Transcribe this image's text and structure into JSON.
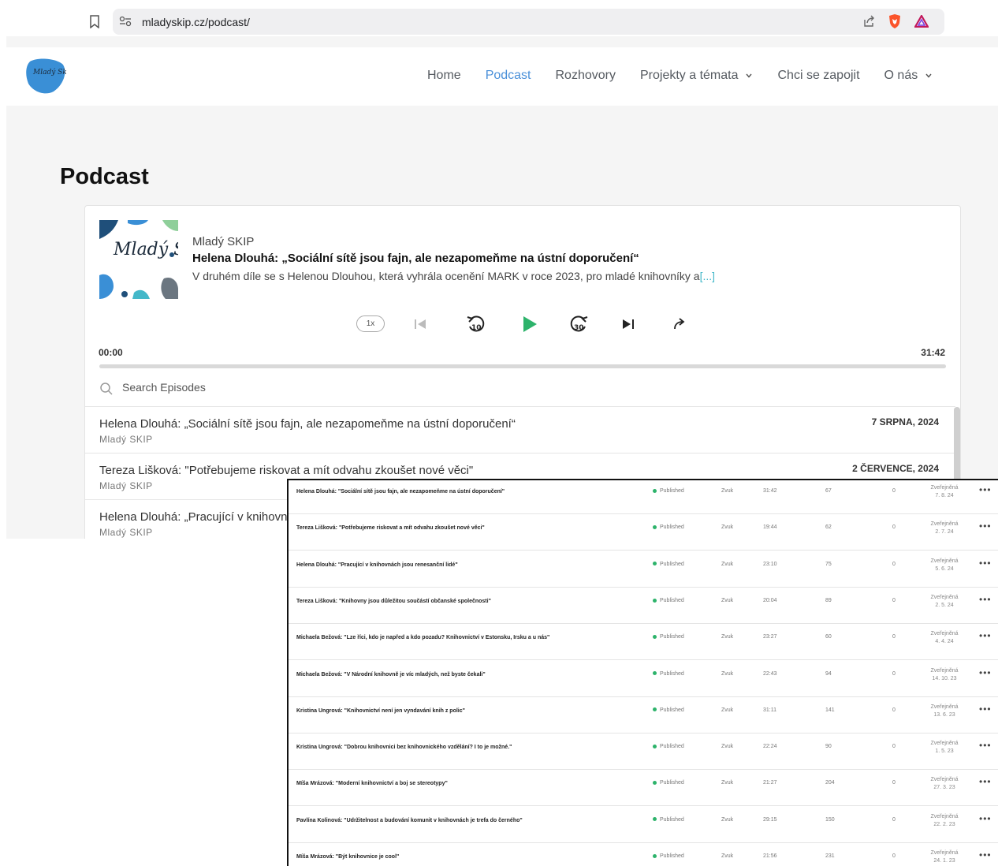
{
  "browser": {
    "url": "mladyskip.cz/podcast/"
  },
  "nav": {
    "items": [
      {
        "label": "Home",
        "active": false,
        "dropdown": false
      },
      {
        "label": "Podcast",
        "active": true,
        "dropdown": false
      },
      {
        "label": "Rozhovory",
        "active": false,
        "dropdown": false
      },
      {
        "label": "Projekty a témata",
        "active": false,
        "dropdown": true
      },
      {
        "label": "Chci se zapojit",
        "active": false,
        "dropdown": false
      },
      {
        "label": "O nás",
        "active": false,
        "dropdown": true
      }
    ]
  },
  "logo_text": "Mladý Skip",
  "page": {
    "title": "Podcast"
  },
  "player": {
    "show_name": "Mladý SKIP",
    "episode_title": "Helena Dlouhá: „Sociální sítě jsou fajn, ale nezapomeňme na ústní doporučení“",
    "description": "V druhém díle se s Helenou Dlouhou, která vyhrála ocenění MARK v roce 2023, pro mladé knihovníky a",
    "more_label": "[...]",
    "speed": "1x",
    "skip_back": "10",
    "skip_forward": "30",
    "time_current": "00:00",
    "time_total": "31:42",
    "progress": 0
  },
  "search": {
    "placeholder": "Search Episodes"
  },
  "episodes": [
    {
      "title": "Helena Dlouhá: „Sociální sítě jsou fajn, ale nezapomeňme na ústní doporučení“",
      "show": "Mladý SKIP",
      "date": "7 SRPNA, 2024"
    },
    {
      "title": "Tereza Lišková: \"Potřebujeme riskovat a mít odvahu zkoušet nové věci\"",
      "show": "Mladý SKIP",
      "date": "2 ČERVENCE, 2024"
    },
    {
      "title": "Helena Dlouhá: „Pracující v knihovnách jsou renesanční lidé“",
      "show": "Mladý SKIP",
      "date": ""
    }
  ],
  "colors": {
    "accent": "#4a90d9",
    "play": "#2db36b",
    "teal": "#44b8c9",
    "published_dot": "#2db36b"
  },
  "admin_table": {
    "status_label": "Published",
    "type_label": "Zvuk",
    "pub_label": "Zveřejněná",
    "rows": [
      {
        "title": "Helena Dlouhá: \"Sociální sítě jsou fajn, ale nezapomeňme na ústní doporučení\"",
        "duration": "31:42",
        "plays": "67",
        "zero": "0",
        "date": "7. 8. 24"
      },
      {
        "title": "Tereza Lišková: \"Potřebujeme riskovat a mít odvahu zkoušet nové věci\"",
        "duration": "19:44",
        "plays": "62",
        "zero": "0",
        "date": "2. 7. 24"
      },
      {
        "title": "Helena Dlouhá: \"Pracující v knihovnách jsou renesanční lidé\"",
        "duration": "23:10",
        "plays": "75",
        "zero": "0",
        "date": "5. 6. 24"
      },
      {
        "title": "Tereza Lišková: \"Knihovny jsou důležitou součástí občanské společnosti\"",
        "duration": "20:04",
        "plays": "89",
        "zero": "0",
        "date": "2. 5. 24"
      },
      {
        "title": "Michaela Bežová: \"Lze říci, kdo je napřed a kdo pozadu? Knihovnictví v Estonsku, Irsku a u nás\"",
        "duration": "23:27",
        "plays": "60",
        "zero": "0",
        "date": "4. 4. 24"
      },
      {
        "title": "Michaela Bežová: \"V Národní knihovně je víc mladých, než byste čekali\"",
        "duration": "22:43",
        "plays": "94",
        "zero": "0",
        "date": "14. 10. 23"
      },
      {
        "title": "Kristina Ungrová: \"Knihovnictví není jen vyndavání knih z polic\"",
        "duration": "31:11",
        "plays": "141",
        "zero": "0",
        "date": "13. 6. 23"
      },
      {
        "title": "Kristina Ungrová: \"Dobrou knihovnici bez knihovnického vzdělání? I to je možné.\"",
        "duration": "22:24",
        "plays": "90",
        "zero": "0",
        "date": "1. 5. 23"
      },
      {
        "title": "Míša Mrázová: \"Moderní knihovnictví a boj se stereotypy\"",
        "duration": "21:27",
        "plays": "204",
        "zero": "0",
        "date": "27. 3. 23"
      },
      {
        "title": "Pavlína Kolinová: \"Udržitelnost a budování komunit v knihovnách je trefa do černého\"",
        "duration": "29:15",
        "plays": "150",
        "zero": "0",
        "date": "22. 2. 23"
      },
      {
        "title": "Míša Mrázová: \"Být knihovnice je cool\"",
        "duration": "21:56",
        "plays": "231",
        "zero": "0",
        "date": "24. 1. 23"
      }
    ]
  }
}
